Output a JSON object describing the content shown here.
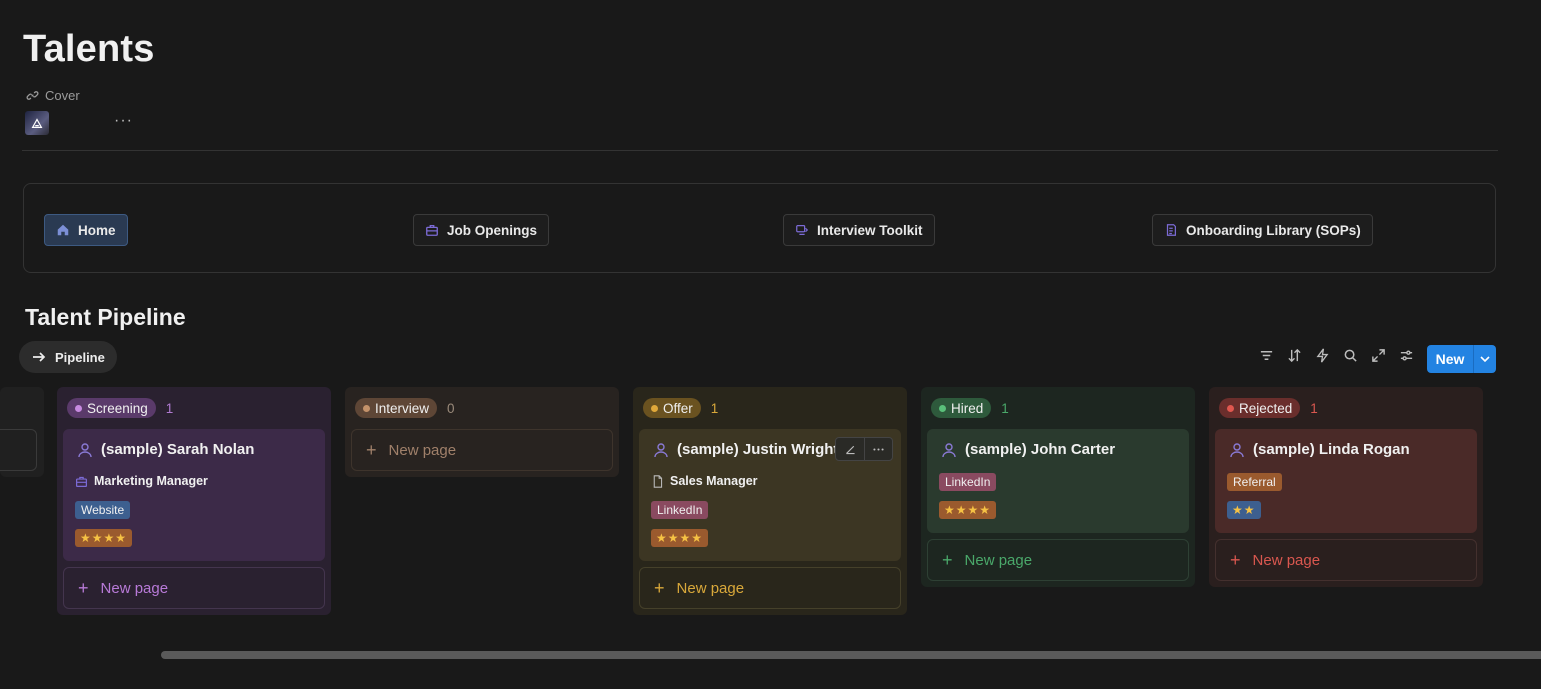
{
  "page": {
    "title": "Talents",
    "cover_label": "Cover",
    "page_icon": "icon-image",
    "more": "···"
  },
  "nav": [
    {
      "label": "Home",
      "icon": "home-icon",
      "active": true
    },
    {
      "label": "Job Openings",
      "icon": "briefcase-icon",
      "active": false
    },
    {
      "label": "Interview Toolkit",
      "icon": "toolkit-icon",
      "active": false
    },
    {
      "label": "Onboarding Library (SOPs)",
      "icon": "book-icon",
      "active": false
    }
  ],
  "section": {
    "title": "Talent Pipeline",
    "view_label": "Pipeline"
  },
  "toolbar": {
    "new_label": "New",
    "tools": [
      "filter-icon",
      "sort-icon",
      "automation-icon",
      "search-icon",
      "expand-icon",
      "settings-icon"
    ]
  },
  "columns": [
    {
      "status": "Screening",
      "count": "1",
      "cards": [
        {
          "name": "(sample) Sarah Nolan",
          "role": "Marketing Manager",
          "source": "Website",
          "rating": "★★★★"
        }
      ],
      "new_page": "New page"
    },
    {
      "status": "Interview",
      "count": "0",
      "cards": [],
      "new_page": "New page"
    },
    {
      "status": "Offer",
      "count": "1",
      "cards": [
        {
          "name": "(sample) Justin Wright",
          "role": "Sales Manager",
          "source": "LinkedIn",
          "rating": "★★★★"
        }
      ],
      "new_page": "New page"
    },
    {
      "status": "Hired",
      "count": "1",
      "cards": [
        {
          "name": "(sample) John Carter",
          "source": "LinkedIn",
          "rating": "★★★★"
        }
      ],
      "new_page": "New page"
    },
    {
      "status": "Rejected",
      "count": "1",
      "cards": [
        {
          "name": "(sample) Linda Rogan",
          "source": "Referral",
          "rating": "★★"
        }
      ],
      "new_page": "New page"
    }
  ],
  "colors": {
    "accent": "#2383e2",
    "screening": "#9b59b6",
    "interview": "#a0785a",
    "offer": "#d9a520",
    "hired": "#3a9c5e",
    "rejected": "#d9574f"
  }
}
